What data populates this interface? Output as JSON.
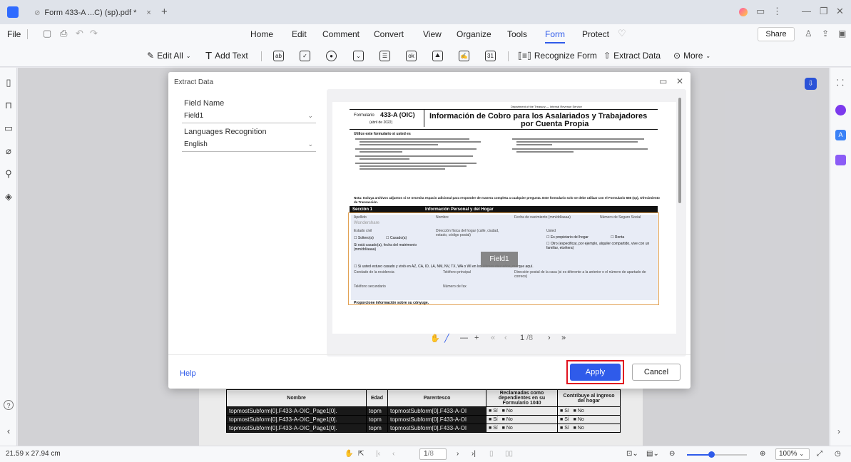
{
  "titlebar": {
    "tab_title": "Form 433-A ...C) (sp).pdf *",
    "close_tab": "×",
    "new_tab": "+"
  },
  "menubar": {
    "file": "File",
    "items": [
      "Home",
      "Edit",
      "Comment",
      "Convert",
      "View",
      "Organize",
      "Tools",
      "Form",
      "Protect"
    ],
    "active": "Form",
    "share": "Share"
  },
  "toolbar": {
    "edit_all": "Edit All",
    "add_text": "Add Text",
    "recognize_form": "Recognize Form",
    "extract_data": "Extract Data",
    "more": "More"
  },
  "dialog": {
    "title": "Extract Data",
    "field_name_label": "Field Name",
    "field_name_value": "Field1",
    "languages_label": "Languages Recognition",
    "languages_value": "English",
    "help": "Help",
    "apply": "Apply",
    "cancel": "Cancel",
    "page_indicator": "1",
    "page_total": "/8",
    "field_tooltip": "Field1"
  },
  "pdf": {
    "dept": "Department of the Treasury — Internal Revenue Service",
    "form_label": "Formulario",
    "form_no": "433-A (OIC)",
    "form_date": "(abril de 2022)",
    "title_line1": "Información de Cobro para los Asalariados y Trabajadores",
    "title_line2": "por Cuenta Propia",
    "use_heading": "Utilice este formulario si usted es",
    "note": "Nota: Incluya archivos adjuntos si se necesita espacio adicional para responder de manera completa a cualquier pregunta. Este formulario solo se debe utilizar con el Formulario 656 (sp), Ofrecimiento de Transacción.",
    "section": "Sección 1",
    "section_title": "Información Personal y del Hogar",
    "col_apellido": "Apellido",
    "col_nombre": "Nombre",
    "col_fecha": "Fecha de nacimiento (mm/dd/aaaa)",
    "col_ssn": "Número de Seguro Social",
    "wondershare": "Wondershare",
    "estado_civil": "Estado civil",
    "soltero": "Soltero(a)",
    "casado": "Casado(a)",
    "si_casado": "Si está casado(a), fecha del matrimonio (mm/dd/aaaa)",
    "direccion": "Dirección física del hogar (calle, ciudad, estado, código postal)",
    "usted": "Usted",
    "propietario": "Es propietario del hogar",
    "renta": "Renta",
    "otro": "Otro (especificar, por ejemplo, alquiler compartido, vive con un familiar, etcétera)",
    "vivio": "Si usted estuvo casado y vivió en AZ, CA, ID, LA, NM, NV, TX, WA o WI en los últimos diez años, marque aquí.",
    "condado": "Condado de la residencia",
    "tel_principal": "Teléfono principal",
    "direccion_postal": "Dirección postal de la casa (si es diferente a la anterior o el número de apartado de correos)",
    "tel_secundario": "Teléfono secundario",
    "fax": "Número de fax",
    "conyuge": "Proporcione información sobre su cónyuge."
  },
  "under_table": {
    "headers": [
      "Nombre",
      "Edad",
      "Parentesco",
      "Reclamadas como dependientes en su Formulario 1040",
      "Contribuye al ingreso del hogar"
    ],
    "rows": [
      [
        "topmostSubform[0].F433-A-OIC_Page1[0].",
        "topm",
        "topmostSubform[0].F433-A-OI",
        "Sí",
        "No",
        "Sí",
        "No"
      ],
      [
        "topmostSubform[0].F433-A-OIC_Page1[0].",
        "topm",
        "topmostSubform[0].F433-A-OI",
        "Sí",
        "No",
        "Sí",
        "No"
      ],
      [
        "topmostSubform[0].F433-A-OIC_Page1[0].",
        "topm",
        "topmostSubform[0].F433-A-OI",
        "Sí",
        "No",
        "Sí",
        "No"
      ]
    ]
  },
  "statusbar": {
    "page_size": "21.59 x 27.94 cm",
    "page_indicator": "1",
    "page_total": "/8",
    "zoom": "100%",
    "zoom_level": 0.4
  }
}
